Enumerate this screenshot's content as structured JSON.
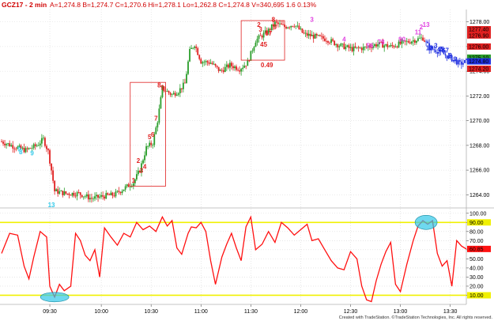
{
  "header": {
    "symbol": "GCZ17 - 2 min",
    "stats": "A=1,274.8  B=1,274.7  C=1,270.6  Hi=1,278.1  Lo=1,262.8  C=1,274.8  V=340,695  1.6  0.13%"
  },
  "footer": {
    "credit": "Created with TradeStation. ©TradeStation Technologies, Inc. All rights reserved."
  },
  "colors": {
    "up": "#2a9d2a",
    "down": "#e02020",
    "blue": "#2030e0",
    "magenta": "#e040e0",
    "cyan": "#30c8e8",
    "yellow": "#f0f000",
    "osc": "#ff1010"
  },
  "chart_data": [
    {
      "type": "candlestick",
      "title": "GCZ17 - 2 min",
      "x_ticks": [
        "09:30",
        "10:00",
        "10:30",
        "11:00",
        "11:30",
        "12:00",
        "12:30",
        "13:00",
        "13:30"
      ],
      "y_ticks": [
        "1264.00",
        "1266.00",
        "1268.00",
        "1270.00",
        "1272.00",
        "1274.00",
        "1276.00",
        "1278.00"
      ],
      "ylim": [
        1263.0,
        1279.0
      ],
      "price_tags": [
        {
          "label": "1277.40",
          "color": "#e02020"
        },
        {
          "label": "1276.90",
          "color": "#e02020"
        },
        {
          "label": "1276.00",
          "color": "#e02020"
        },
        {
          "label": "1275.10",
          "color": "#2a9d2a"
        },
        {
          "label": "1274.80",
          "color": "#2030e0"
        },
        {
          "label": "1274.20",
          "color": "#e02020"
        }
      ],
      "box_annotation": "0.49",
      "count_labels": [
        {
          "text": "9",
          "slot": 11,
          "price": 1267.5,
          "color": "#30c8e8"
        },
        {
          "text": "8",
          "slot": 12,
          "price": 1267.3,
          "color": "#30c8e8"
        },
        {
          "text": "9",
          "slot": 19,
          "price": 1267.2,
          "color": "#30c8e8"
        },
        {
          "text": "13",
          "slot": 31,
          "price": 1263.0,
          "color": "#30c8e8"
        },
        {
          "text": "1",
          "slot": 82,
          "price": 1265.0,
          "color": "#e02020"
        },
        {
          "text": "2",
          "slot": 85,
          "price": 1266.6,
          "color": "#e02020"
        },
        {
          "text": "3",
          "slot": 87,
          "price": 1265.8,
          "color": "#e02020"
        },
        {
          "text": "4",
          "slot": 89,
          "price": 1266.1,
          "color": "#e02020"
        },
        {
          "text": "5",
          "slot": 92,
          "price": 1268.5,
          "color": "#e02020"
        },
        {
          "text": "6",
          "slot": 94,
          "price": 1268.7,
          "color": "#e02020"
        },
        {
          "text": "7",
          "slot": 96,
          "price": 1270.0,
          "color": "#e02020"
        },
        {
          "text": "8",
          "slot": 98,
          "price": 1272.7,
          "color": "#e02020"
        },
        {
          "text": "9",
          "slot": 100,
          "price": 1272.5,
          "color": "#e02020"
        },
        {
          "text": "2",
          "slot": 160,
          "price": 1277.6,
          "color": "#e02020"
        },
        {
          "text": "3",
          "slot": 161,
          "price": 1277.2,
          "color": "#e02020"
        },
        {
          "text": "45",
          "slot": 163,
          "price": 1276.0,
          "color": "#e02020"
        },
        {
          "text": "67",
          "slot": 166,
          "price": 1276.9,
          "color": "#e02020"
        },
        {
          "text": "8",
          "slot": 169,
          "price": 1278.0,
          "color": "#e02020"
        },
        {
          "text": "9",
          "slot": 170,
          "price": 1277.4,
          "color": "#e02020"
        },
        {
          "text": "3",
          "slot": 193,
          "price": 1278.0,
          "color": "#e040e0"
        },
        {
          "text": "4",
          "slot": 213,
          "price": 1276.4,
          "color": "#e040e0"
        },
        {
          "text": "56",
          "slot": 229,
          "price": 1275.9,
          "color": "#e040e0"
        },
        {
          "text": "78",
          "slot": 236,
          "price": 1276.2,
          "color": "#e040e0"
        },
        {
          "text": "90",
          "slot": 249,
          "price": 1276.4,
          "color": "#e040e0"
        },
        {
          "text": "11",
          "slot": 259,
          "price": 1277.0,
          "color": "#e040e0"
        },
        {
          "text": "2",
          "slot": 261,
          "price": 1277.4,
          "color": "#e040e0"
        },
        {
          "text": "13",
          "slot": 264,
          "price": 1277.6,
          "color": "#e040e0"
        },
        {
          "text": "12",
          "slot": 266,
          "price": 1275.7,
          "color": "#2030e0"
        },
        {
          "text": "3",
          "slot": 270,
          "price": 1275.9,
          "color": "#2030e0"
        },
        {
          "text": "45",
          "slot": 273,
          "price": 1275.6,
          "color": "#2030e0"
        },
        {
          "text": "67",
          "slot": 276,
          "price": 1275.5,
          "color": "#2030e0"
        },
        {
          "text": "8",
          "slot": 279,
          "price": 1275.1,
          "color": "#2030e0"
        },
        {
          "text": "9",
          "slot": 282,
          "price": 1274.8,
          "color": "#2030e0"
        }
      ]
    },
    {
      "type": "line",
      "y_ticks": [
        "100.00",
        "90.00",
        "80.00",
        "70.00",
        "60.00",
        "50.00",
        "40.00",
        "30.00",
        "20.00",
        "10.00"
      ],
      "ylim": [
        0,
        105
      ],
      "reference_lines": [
        90,
        10
      ],
      "last_value": "60.85",
      "reference_labels": [
        "90.00",
        "10.00"
      ],
      "x_ticks": [
        "09:30",
        "10:00",
        "10:30",
        "11:00",
        "11:30",
        "12:00",
        "12:30",
        "13:00",
        "13:30"
      ]
    }
  ]
}
